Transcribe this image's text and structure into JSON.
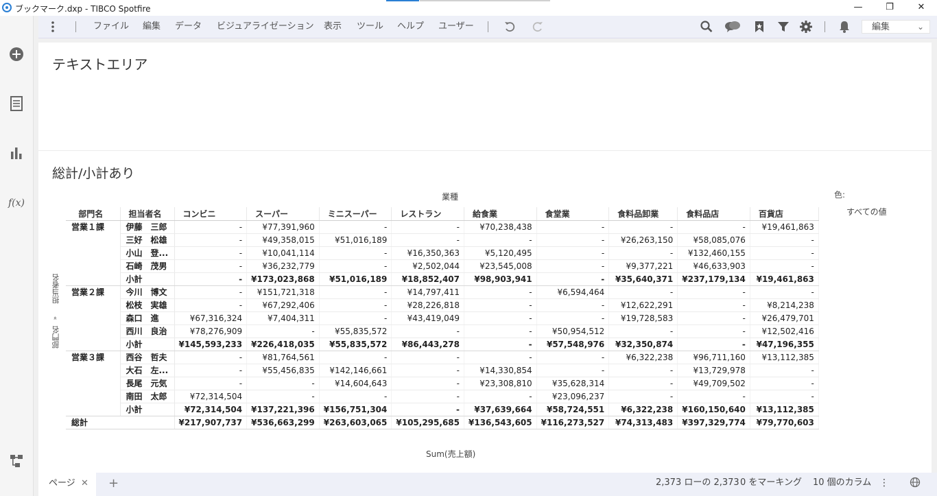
{
  "window": {
    "title": "ブックマーク.dxp - TIBCO Spotfire",
    "minimize": "—",
    "maximize": "❐",
    "close": "✕"
  },
  "toolbar": {
    "menus": [
      "ファイル",
      "編集",
      "データ",
      "ビジュアライゼーション",
      "表示",
      "ツール",
      "ヘルプ",
      "ユーザー"
    ],
    "mode_select": "編集"
  },
  "text_area": {
    "title": "テキストエリア"
  },
  "visualization": {
    "title": "総計/小計あり",
    "column_axis": "業種",
    "row_axis": [
      "部門名",
      "»",
      "担当者名"
    ],
    "color_label": "色:",
    "color_value": "すべての値",
    "value_axis": "Sum(売上額)",
    "headers": {
      "dept": "部門名",
      "person": "担当者名",
      "columns": [
        "コンビニ",
        "スーパー",
        "ミニスーパー",
        "レストラン",
        "給食業",
        "食堂業",
        "食料品卸業",
        "食料品店",
        "百貨店"
      ]
    },
    "groups": [
      {
        "dept": "営業１課",
        "rows": [
          {
            "person": "伊藤　三郎",
            "values": [
              "-",
              "¥77,391,960",
              "-",
              "-",
              "¥70,238,438",
              "-",
              "-",
              "-",
              "¥19,461,863"
            ]
          },
          {
            "person": "三好　松雄",
            "values": [
              "-",
              "¥49,358,015",
              "¥51,016,189",
              "-",
              "-",
              "-",
              "¥26,263,150",
              "¥58,085,076",
              "-"
            ]
          },
          {
            "person": "小山　登...",
            "values": [
              "-",
              "¥10,041,114",
              "-",
              "¥16,350,363",
              "¥5,120,495",
              "-",
              "-",
              "¥132,460,155",
              "-"
            ]
          },
          {
            "person": "石崎　茂男",
            "values": [
              "-",
              "¥36,232,779",
              "-",
              "¥2,502,044",
              "¥23,545,008",
              "-",
              "¥9,377,221",
              "¥46,633,903",
              "-"
            ]
          }
        ],
        "subtotal_label": "小計",
        "subtotal": [
          "-",
          "¥173,023,868",
          "¥51,016,189",
          "¥18,852,407",
          "¥98,903,941",
          "-",
          "¥35,640,371",
          "¥237,179,134",
          "¥19,461,863"
        ]
      },
      {
        "dept": "営業２課",
        "rows": [
          {
            "person": "今川　博文",
            "values": [
              "-",
              "¥151,721,318",
              "-",
              "¥14,797,411",
              "-",
              "¥6,594,464",
              "-",
              "-",
              "-"
            ]
          },
          {
            "person": "松枝　実雄",
            "values": [
              "-",
              "¥67,292,406",
              "-",
              "¥28,226,818",
              "-",
              "-",
              "¥12,622,291",
              "-",
              "¥8,214,238"
            ]
          },
          {
            "person": "森口　進",
            "values": [
              "¥67,316,324",
              "¥7,404,311",
              "-",
              "¥43,419,049",
              "-",
              "-",
              "¥19,728,583",
              "-",
              "¥26,479,701"
            ]
          },
          {
            "person": "西川　良治",
            "values": [
              "¥78,276,909",
              "-",
              "¥55,835,572",
              "-",
              "-",
              "¥50,954,512",
              "-",
              "-",
              "¥12,502,416"
            ]
          }
        ],
        "subtotal_label": "小計",
        "subtotal": [
          "¥145,593,233",
          "¥226,418,035",
          "¥55,835,572",
          "¥86,443,278",
          "-",
          "¥57,548,976",
          "¥32,350,874",
          "-",
          "¥47,196,355"
        ]
      },
      {
        "dept": "営業３課",
        "rows": [
          {
            "person": "西谷　哲夫",
            "values": [
              "-",
              "¥81,764,561",
              "-",
              "-",
              "-",
              "-",
              "¥6,322,238",
              "¥96,711,160",
              "¥13,112,385"
            ]
          },
          {
            "person": "大石　左...",
            "values": [
              "-",
              "¥55,456,835",
              "¥142,146,661",
              "-",
              "¥14,330,854",
              "-",
              "-",
              "¥13,729,978",
              "-"
            ]
          },
          {
            "person": "長尾　元気",
            "values": [
              "-",
              "-",
              "¥14,604,643",
              "-",
              "¥23,308,810",
              "¥35,628,314",
              "-",
              "¥49,709,502",
              "-"
            ]
          },
          {
            "person": "南田　太郎",
            "values": [
              "¥72,314,504",
              "-",
              "-",
              "-",
              "-",
              "¥23,096,237",
              "-",
              "-",
              "-"
            ]
          }
        ],
        "subtotal_label": "小計",
        "subtotal": [
          "¥72,314,504",
          "¥137,221,396",
          "¥156,751,304",
          "-",
          "¥37,639,664",
          "¥58,724,551",
          "¥6,322,238",
          "¥160,150,640",
          "¥13,112,385"
        ]
      }
    ],
    "grand_total_label": "総計",
    "grand_total": [
      "¥217,907,737",
      "¥536,663,299",
      "¥263,603,065",
      "¥105,295,685",
      "¥136,543,605",
      "¥116,273,527",
      "¥74,313,483",
      "¥397,329,774",
      "¥79,770,603"
    ]
  },
  "statusbar": {
    "page_tab": "ページ",
    "rows": "2,373 ローの 2,373",
    "marked": "0 をマーキング",
    "columns": "10 個のカラム"
  }
}
